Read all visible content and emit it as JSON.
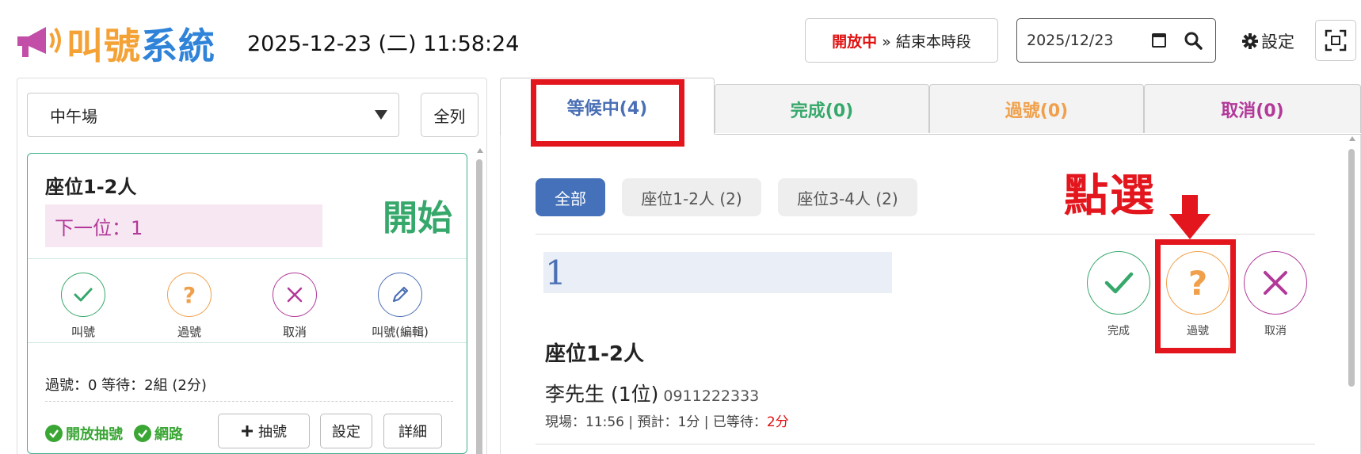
{
  "header": {
    "logo_part1": "叫號",
    "logo_part2": "系統",
    "datetime": "2025-12-23 (二) 11:58:24",
    "status_open": "開放中",
    "status_rest": "» 結束本時段",
    "date_value": "2025/12/23",
    "settings_label": "設定",
    "icons": [
      "calendar-icon",
      "search-icon",
      "gear-icon",
      "fullscreen-icon"
    ]
  },
  "left_panel": {
    "session_selected": "中午場",
    "all_button": "全列",
    "card": {
      "title": "座位1-2人",
      "next_label": "下一位：1",
      "start_label": "開始",
      "actions": [
        {
          "label": "叫號",
          "icon": "check-icon",
          "color": "#36a86b"
        },
        {
          "label": "過號",
          "icon": "question-icon",
          "color": "#f0a04b"
        },
        {
          "label": "取消",
          "icon": "close-icon",
          "color": "#b2399a"
        },
        {
          "label": "叫號(編輯)",
          "icon": "pencil-icon",
          "color": "#4a6fb5"
        }
      ],
      "stats": "過號：0   等待：2組 (2分)",
      "flag_open": "開放抽號",
      "flag_network": "網路",
      "btn_take": "抽號",
      "btn_settings": "設定",
      "btn_detail": "詳細"
    }
  },
  "right_panel": {
    "tabs": [
      {
        "label": "等候中(4)",
        "color": "#4a6fb5",
        "active": true
      },
      {
        "label": "完成(0)",
        "color": "#36a86b",
        "active": false
      },
      {
        "label": "過號(0)",
        "color": "#f0a04b",
        "active": false
      },
      {
        "label": "取消(0)",
        "color": "#b2399a",
        "active": false
      }
    ],
    "filters": [
      {
        "label": "全部",
        "active": true
      },
      {
        "label": "座位1-2人 (2)",
        "active": false
      },
      {
        "label": "座位3-4人 (2)",
        "active": false
      }
    ],
    "entry": {
      "number": "1",
      "seat_type": "座位1-2人",
      "customer_name": "李先生 (1位)",
      "phone": "0911222333",
      "meta_prefix": "現場：11:56 | 預計：1分 | 已等待：",
      "wait": "2分",
      "actions": [
        {
          "label": "完成",
          "icon": "check-icon",
          "color": "#36a86b"
        },
        {
          "label": "過號",
          "icon": "question-icon",
          "color": "#f0a04b"
        },
        {
          "label": "取消",
          "icon": "close-icon",
          "color": "#b2399a"
        }
      ]
    }
  },
  "annotation": {
    "text": "點選",
    "color": "#e3161e"
  }
}
